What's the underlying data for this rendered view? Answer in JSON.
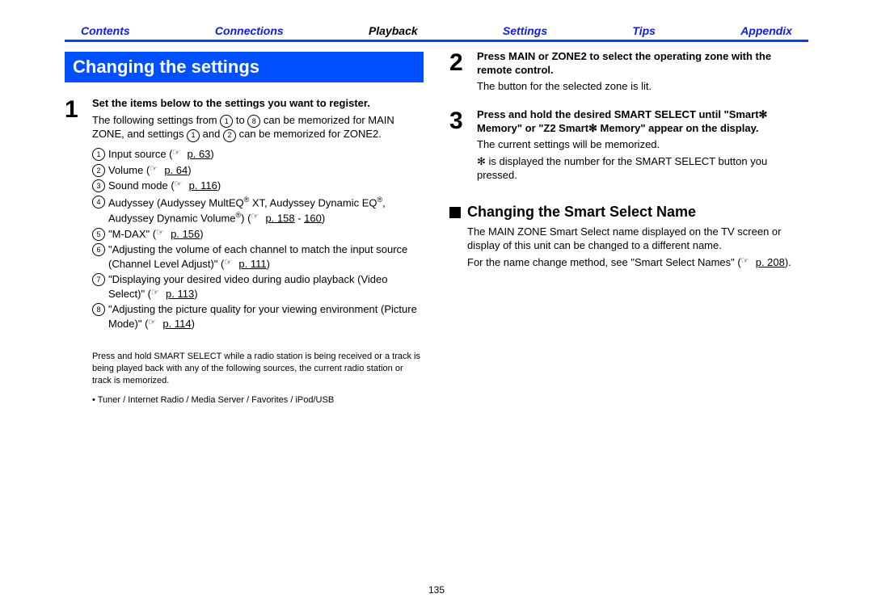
{
  "nav": {
    "items": [
      "Contents",
      "Connections",
      "Playback",
      "Settings",
      "Tips",
      "Appendix"
    ],
    "current": "Playback"
  },
  "heading": "Changing the settings",
  "step1": {
    "num": "1",
    "bold": "Set the items below to the settings you want to register.",
    "follow_a": "The following settings from ",
    "follow_b": " to ",
    "follow_c": " can be memorized for MAIN ZONE, and settings ",
    "follow_d": " and ",
    "follow_e": " can be memorized for ZONE2.",
    "f1": "1",
    "f8": "8",
    "f1b": "1",
    "f2": "2",
    "items": [
      {
        "n": "1",
        "pre": "Input source  (",
        "page": "p. 63",
        "post": ")"
      },
      {
        "n": "2",
        "pre": "Volume  (",
        "page": "p. 64",
        "post": ")"
      },
      {
        "n": "3",
        "pre": "Sound mode (",
        "page": "p. 116",
        "post": ")"
      },
      {
        "n": "4",
        "pre": "Audyssey (Audyssey MultEQ",
        "reg": "®",
        "pre2": " XT, Audyssey Dynamic EQ",
        "reg2": "®",
        "pre3": ", Audyssey Dynamic Volume",
        "reg3": "®",
        "pre4": ")  (",
        "page": "p. 158",
        "post": " - ",
        "page2": "160",
        "post2": ")"
      },
      {
        "n": "5",
        "pre": "\"M-DAX\" (",
        "page": "p. 156",
        "post": ")"
      },
      {
        "n": "6",
        "pre": "\"Adjusting the volume of each channel to match the input source (Channel Level Adjust)\" (",
        "page": "p. 111",
        "post": ")"
      },
      {
        "n": "7",
        "pre": "\"Displaying your desired video during audio playback (Video Select)\" (",
        "page": "p. 113",
        "post": ")"
      },
      {
        "n": "8",
        "pre": "\"Adjusting the picture quality for your viewing environment (Picture Mode)\" (",
        "page": "p. 114",
        "post": ")"
      }
    ],
    "note1": "Press and hold SMART SELECT while a radio station is being received or a track is being played back with any of the following sources, the current radio station or track is memorized.",
    "note2": "Tuner / Internet Radio / Media Server / Favorites / iPod/USB"
  },
  "step2": {
    "num": "2",
    "bold": "Press MAIN or ZONE2 to select the operating zone with the remote control.",
    "line": "The button for the selected zone is lit."
  },
  "step3": {
    "num": "3",
    "bold": "Press and hold the desired SMART SELECT until \"Smart✻ Memory\" or \"Z2 Smart✻ Memory\" appear on the display.",
    "line1": "The current settings will be memorized.",
    "line2": "✻ is displayed the number for the SMART SELECT button you pressed."
  },
  "sub": {
    "title": "Changing the Smart Select Name",
    "p1": "The MAIN ZONE Smart Select name displayed on the TV screen or display of this unit can be changed to a different name.",
    "p2a": "For the name change method, see \"Smart Select Names\" (",
    "page": "p. 208",
    "p2b": ")."
  },
  "page_number": "135"
}
